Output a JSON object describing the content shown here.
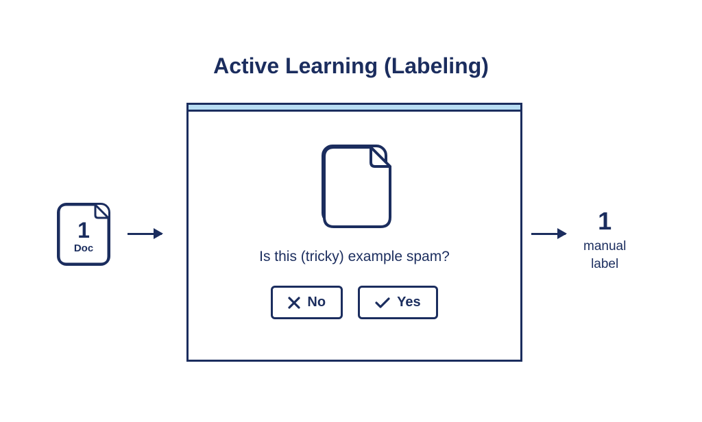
{
  "title": "Active Learning (Labeling)",
  "input": {
    "count": "1",
    "label": "Doc"
  },
  "panel": {
    "question": "Is this (tricky) example spam?",
    "no_label": "No",
    "yes_label": "Yes"
  },
  "output": {
    "count": "1",
    "label_line1": "manual",
    "label_line2": "label"
  },
  "colors": {
    "primary": "#1b2d5e",
    "header_fill": "#b8ddf3"
  }
}
